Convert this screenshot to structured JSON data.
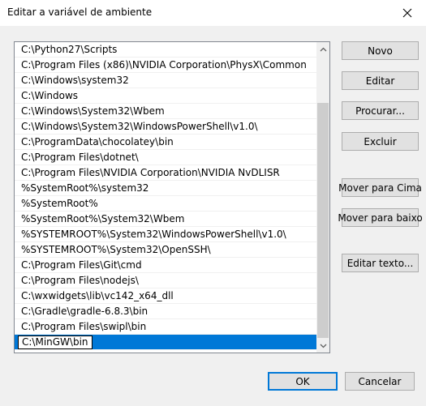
{
  "window": {
    "title": "Editar a variável de ambiente",
    "close_icon": "close-icon"
  },
  "paths": [
    "C:\\Python27\\Scripts",
    "C:\\Program Files (x86)\\NVIDIA Corporation\\PhysX\\Common",
    "C:\\Windows\\system32",
    "C:\\Windows",
    "C:\\Windows\\System32\\Wbem",
    "C:\\Windows\\System32\\WindowsPowerShell\\v1.0\\",
    "C:\\ProgramData\\chocolatey\\bin",
    "C:\\Program Files\\dotnet\\",
    "C:\\Program Files\\NVIDIA Corporation\\NVIDIA NvDLISR",
    "%SystemRoot%\\system32",
    "%SystemRoot%",
    "%SystemRoot%\\System32\\Wbem",
    "%SYSTEMROOT%\\System32\\WindowsPowerShell\\v1.0\\",
    "%SYSTEMROOT%\\System32\\OpenSSH\\",
    "C:\\Program Files\\Git\\cmd",
    "C:\\Program Files\\nodejs\\",
    "C:\\wxwidgets\\lib\\vc142_x64_dll",
    "C:\\Gradle\\gradle-6.8.3\\bin",
    "C:\\Program Files\\swipl\\bin"
  ],
  "editing_value": "C:\\MinGW\\bin",
  "buttons": {
    "novo": "Novo",
    "editar": "Editar",
    "procurar": "Procurar...",
    "excluir": "Excluir",
    "mover_cima": "Mover para Cima",
    "mover_baixo": "Mover para baixo",
    "editar_texto": "Editar texto...",
    "ok": "OK",
    "cancelar": "Cancelar"
  },
  "colors": {
    "selection": "#0078d7",
    "background": "#f0f0f0"
  }
}
